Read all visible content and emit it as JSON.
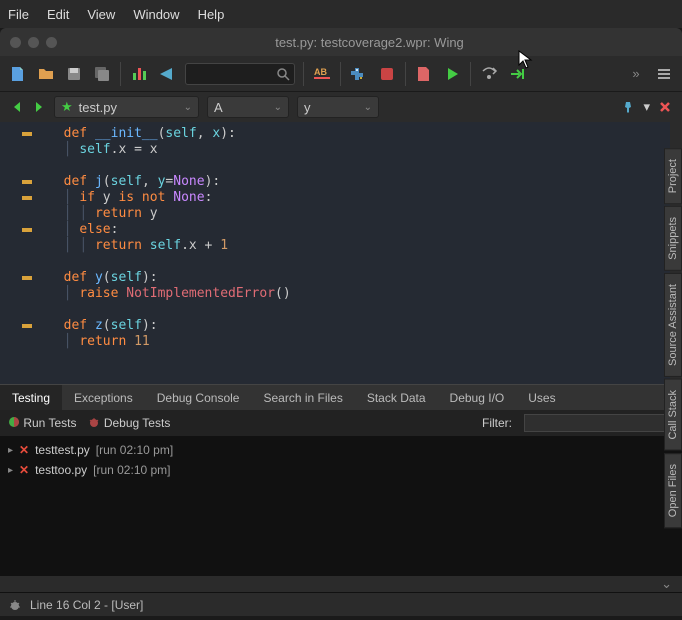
{
  "menubar": [
    "File",
    "Edit",
    "View",
    "Window",
    "Help"
  ],
  "title": "test.py: testcoverage2.wpr: Wing",
  "file_dropdown": {
    "star": true,
    "name": "test.py"
  },
  "symbol_dropdowns": [
    "A",
    "y"
  ],
  "code_lines": [
    {
      "indent": 0,
      "html": "<span class='kw'>def</span> <span class='fn'>__init__</span>(<span class='param'>self</span>, <span class='param'>x</span>):",
      "mark": true
    },
    {
      "indent": 1,
      "html": "<span class='param'>self</span>.x = x"
    },
    {
      "indent": 0,
      "html": ""
    },
    {
      "indent": 0,
      "html": "<span class='kw'>def</span> <span class='fn'>j</span>(<span class='param'>self</span>, <span class='param'>y</span>=<span class='const'>None</span>):",
      "mark": true
    },
    {
      "indent": 1,
      "html": "<span class='kw'>if</span> y <span class='kw'>is not</span> <span class='const'>None</span>:",
      "mark": true
    },
    {
      "indent": 2,
      "html": "<span class='kw'>return</span> y"
    },
    {
      "indent": 1,
      "html": "<span class='kw'>else</span>:",
      "mark": true
    },
    {
      "indent": 2,
      "html": "<span class='kw'>return</span> <span class='param'>self</span>.x + <span class='num'>1</span>"
    },
    {
      "indent": 0,
      "html": ""
    },
    {
      "indent": 0,
      "html": "<span class='kw'>def</span> <span class='fn'>y</span>(<span class='param'>self</span>):",
      "mark": true
    },
    {
      "indent": 1,
      "html": "<span class='kw'>raise</span> <span class='err'>NotImplementedError</span>()"
    },
    {
      "indent": 0,
      "html": ""
    },
    {
      "indent": 0,
      "html": "<span class='kw'>def</span> <span class='fn'>z</span>(<span class='param'>self</span>):",
      "mark": true
    },
    {
      "indent": 1,
      "html": "<span class='kw'>return</span> <span class='num'>11</span>"
    }
  ],
  "right_panels": [
    "Project",
    "Snippets",
    "Source Assistant",
    "Call Stack",
    "Open Files"
  ],
  "bottom_tabs": [
    "Testing",
    "Exceptions",
    "Debug Console",
    "Search in Files",
    "Stack Data",
    "Debug I/O",
    "Uses"
  ],
  "active_bottom_tab": "Testing",
  "testing": {
    "run_label": "Run Tests",
    "debug_label": "Debug Tests",
    "filter_label": "Filter:",
    "results": [
      {
        "status": "fail",
        "file": "testtest.py",
        "run": "[run 02:10 pm]"
      },
      {
        "status": "fail",
        "file": "testtoo.py",
        "run": "[run 02:10 pm]"
      }
    ]
  },
  "statusbar": {
    "position": "Line 16 Col 2 - [User]"
  }
}
